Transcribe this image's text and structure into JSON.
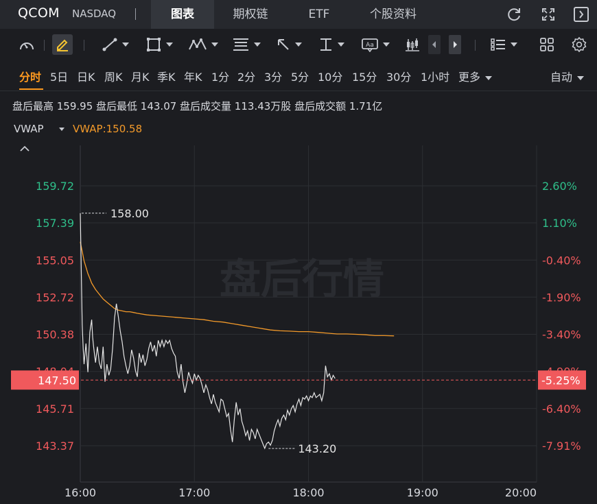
{
  "header": {
    "symbol": "QCOM",
    "exchange": "NASDAQ",
    "tabs": [
      {
        "label": "图表",
        "active": true
      },
      {
        "label": "期权链",
        "active": false
      },
      {
        "label": "ETF",
        "active": false
      },
      {
        "label": "个股资料",
        "active": false
      }
    ],
    "icons": [
      "refresh-icon",
      "fullscreen-icon",
      "collapse-panel-icon"
    ]
  },
  "toolbar": {
    "tools": [
      "indicator-gauge-icon",
      "pen-icon",
      "line-tool-icon",
      "rectangle-tool-icon",
      "pattern-tool-icon",
      "fib-tool-icon",
      "arrow-tool-icon",
      "measure-tool-icon",
      "text-tool-icon",
      "candle-style-icon",
      "prev-icon",
      "next-icon",
      "list-icon",
      "grid-layout-icon",
      "settings-icon"
    ]
  },
  "periods": {
    "items": [
      "分时",
      "5日",
      "日K",
      "周K",
      "月K",
      "季K",
      "年K",
      "1分",
      "2分",
      "3分",
      "5分",
      "10分",
      "15分",
      "30分",
      "1小时",
      "更多"
    ],
    "active": "分时",
    "mode": "自动"
  },
  "stats": {
    "text": "盘后最高 159.95  盘后最低 143.07  盘后成交量 113.43万股  盘后成交额 1.71亿"
  },
  "indicator": {
    "name": "VWAP",
    "value_label": "VWAP:150.58"
  },
  "colors": {
    "background": "#1c1d21",
    "price_line": "#e6e6e6",
    "vwap_line": "#f39a2a",
    "up": "#2fbf8a",
    "down": "#f0595c",
    "current_tag": "#f0595c",
    "grid": "#2c2e33"
  },
  "chart_data": {
    "type": "line",
    "watermark": "盘后行情",
    "ylim": [
      142.2,
      161.5
    ],
    "y_ticks_left": [
      "159.72",
      "157.39",
      "155.05",
      "152.72",
      "150.38",
      "148.04",
      "145.71",
      "143.37"
    ],
    "y_ticks_left_values": [
      159.72,
      157.39,
      155.05,
      152.72,
      150.38,
      148.04,
      145.71,
      143.37
    ],
    "y_ticks_right": [
      "2.60%",
      "1.10%",
      "-0.40%",
      "-1.90%",
      "-3.40%",
      "-4.90%",
      "-6.40%",
      "-7.91%"
    ],
    "x_ticks": [
      "16:00",
      "17:00",
      "18:00",
      "19:00",
      "20:00"
    ],
    "x_tick_minutes": [
      0,
      60,
      120,
      180,
      240
    ],
    "current_price": "147.50",
    "current_change": "-5.25%",
    "high_label": "158.00",
    "low_label": "143.20",
    "series": [
      {
        "name": "price",
        "x_minutes": [
          0,
          1,
          1.5,
          2,
          3,
          4,
          5,
          6,
          6.5,
          7,
          8,
          9,
          10,
          11,
          12,
          13,
          14,
          15,
          16,
          17,
          18,
          19,
          20,
          21,
          22,
          23,
          24,
          25,
          26,
          27,
          28,
          29,
          30,
          31,
          32,
          33,
          34,
          35,
          36,
          37,
          38,
          39,
          40,
          41,
          42,
          43,
          44,
          45,
          46,
          47,
          48,
          49,
          50,
          51,
          52,
          53,
          54,
          55,
          56,
          57,
          58,
          59,
          60,
          61,
          62,
          63,
          64,
          65,
          66,
          67,
          68,
          69,
          70,
          71,
          72,
          73,
          74,
          75,
          76,
          77,
          78,
          79,
          80,
          81,
          82,
          83,
          84,
          85,
          86,
          87,
          88,
          89,
          90,
          91,
          92,
          93,
          94,
          95,
          96,
          97,
          98,
          99,
          100,
          101,
          102,
          103,
          104,
          105,
          106,
          107,
          108,
          109,
          110,
          111,
          112,
          113,
          114,
          115,
          116,
          117,
          118,
          119,
          120,
          121,
          122,
          123,
          124,
          125,
          126,
          127,
          128,
          129,
          130,
          131,
          132,
          133,
          134,
          135,
          136,
          137,
          138,
          139,
          140,
          141,
          142,
          143,
          144,
          145,
          146,
          147,
          148,
          149,
          150,
          151,
          152,
          153,
          154,
          155,
          156,
          157,
          158,
          159,
          160,
          161,
          162,
          163,
          164,
          165,
          166,
          167,
          168,
          169,
          170,
          171
        ],
        "values": [
          158.0,
          151.0,
          149.5,
          148.5,
          149.8,
          148.0,
          150.5,
          151.3,
          150.2,
          149.6,
          148.6,
          149.6,
          148.6,
          148.2,
          149.6,
          147.4,
          148.5,
          147.8,
          148.2,
          149.5,
          151.4,
          152.3,
          151.5,
          150.6,
          149.9,
          149.0,
          148.4,
          147.9,
          148.4,
          149.4,
          148.9,
          148.1,
          147.7,
          149.2,
          148.6,
          149.1,
          148.4,
          148.8,
          149.5,
          149.9,
          149.3,
          149.7,
          149.0,
          150.0,
          149.6,
          150.0,
          149.6,
          150.0,
          149.8,
          150.0,
          149.5,
          149.2,
          149.0,
          148.0,
          147.6,
          148.5,
          147.4,
          146.7,
          147.3,
          148.0,
          147.6,
          147.3,
          147.9,
          147.5,
          147.8,
          147.6,
          147.2,
          146.7,
          147.2,
          146.9,
          146.4,
          146.0,
          146.6,
          146.1,
          145.8,
          145.5,
          146.3,
          146.2,
          145.7,
          145.2,
          145.4,
          144.4,
          143.6,
          145.0,
          146.1,
          145.3,
          145.7,
          144.9,
          144.5,
          144.0,
          144.3,
          143.7,
          144.4,
          144.2,
          143.8,
          144.4,
          144.1,
          143.8,
          143.5,
          143.2,
          143.5,
          143.6,
          143.4,
          143.7,
          144.3,
          144.7,
          145.0,
          144.6,
          145.1,
          145.3,
          145.0,
          145.6,
          145.3,
          145.7,
          145.9,
          145.5,
          146.0,
          146.3,
          145.9,
          146.4,
          146.3,
          146.5,
          146.2,
          146.5,
          146.4,
          146.7,
          146.4,
          146.5,
          146.6,
          146.2,
          146.7,
          148.4,
          147.7,
          147.9,
          147.5,
          147.8,
          147.6
        ]
      },
      {
        "name": "VWAP",
        "x_minutes": [
          0,
          1,
          2,
          3,
          4,
          5,
          6,
          8,
          10,
          12,
          14,
          16,
          18,
          20,
          22,
          24,
          26,
          28,
          30,
          35,
          40,
          45,
          50,
          55,
          60,
          65,
          70,
          75,
          80,
          85,
          90,
          95,
          100,
          105,
          110,
          115,
          120,
          125,
          130,
          135,
          140,
          145,
          150,
          155,
          160,
          165
        ],
        "values": [
          156.2,
          155.6,
          155.0,
          154.6,
          154.2,
          153.9,
          153.6,
          153.2,
          152.9,
          152.6,
          152.4,
          152.2,
          152.0,
          151.9,
          151.85,
          151.8,
          151.8,
          151.75,
          151.7,
          151.6,
          151.55,
          151.5,
          151.45,
          151.4,
          151.35,
          151.3,
          151.2,
          151.15,
          151.05,
          150.95,
          150.85,
          150.75,
          150.65,
          150.6,
          150.58,
          150.55,
          150.55,
          150.5,
          150.45,
          150.4,
          150.4,
          150.38,
          150.35,
          150.3,
          150.3,
          150.28
        ]
      }
    ]
  }
}
